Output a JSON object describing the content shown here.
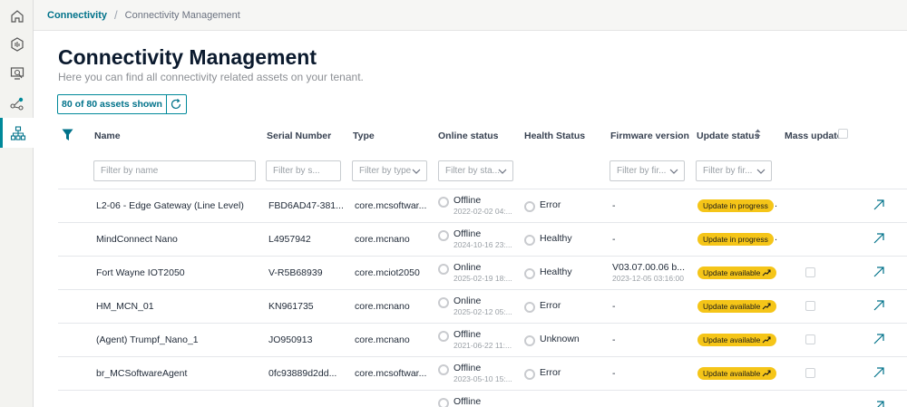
{
  "nav": {
    "items": [
      {
        "icon": "home-icon"
      },
      {
        "icon": "dashboard-icon"
      },
      {
        "icon": "search-monitor-icon"
      },
      {
        "icon": "connection-icon"
      },
      {
        "icon": "hierarchy-icon"
      }
    ]
  },
  "breadcrumb": {
    "link": "Connectivity",
    "current": "Connectivity Management"
  },
  "page": {
    "title": "Connectivity Management",
    "subtitle": "Here you can find all connectivity related assets on your tenant."
  },
  "counter": {
    "label": "80 of 80 assets shown"
  },
  "columns": {
    "name": "Name",
    "serial": "Serial Number",
    "type": "Type",
    "online": "Online status",
    "health": "Health Status",
    "firmware": "Firmware version",
    "update": "Update status",
    "mass": "Mass update"
  },
  "filters": {
    "name": "Filter by name",
    "serial": "Filter by s...",
    "type": "Filter by type",
    "online": "Filter by sta...",
    "firmware": "Filter by fir...",
    "update": "Filter by fir..."
  },
  "colors": {
    "accent": "#00899a",
    "online": "#1a7f37",
    "offline": "#c9cbcf",
    "error": "#c8102e",
    "healthy": "#1a7f37",
    "unknown": "#c9cbcf",
    "pill": "#f5c518"
  },
  "rows": [
    {
      "name": "L2-06 - Edge Gateway (Line Level)",
      "serial": "FBD6AD47-381...",
      "type": "core.mcsoftwar...",
      "online": "Offline",
      "online_time": "2022-02-02 04:...",
      "online_state": "offline",
      "health": "Error",
      "health_state": "error",
      "firmware": "-",
      "firmware_time": "",
      "update": "Update in progress",
      "update_suffix": "."
    },
    {
      "name": "MindConnect Nano",
      "serial": "L4957942",
      "type": "core.mcnano",
      "online": "Offline",
      "online_time": "2024-10-16 23:...",
      "online_state": "offline",
      "health": "Healthy",
      "health_state": "healthy",
      "firmware": "-",
      "firmware_time": "",
      "update": "Update in progress",
      "update_suffix": "."
    },
    {
      "name": "Fort Wayne IOT2050",
      "serial": "V-R5B68939",
      "type": "core.mciot2050",
      "online": "Online",
      "online_time": "2025-02-19 18:...",
      "online_state": "online",
      "health": "Healthy",
      "health_state": "healthy",
      "firmware": "V03.07.00.06 b...",
      "firmware_time": "2023-12-05 03:16:00",
      "update": "Update available",
      "update_suffix": ""
    },
    {
      "name": "HM_MCN_01",
      "serial": "KN961735",
      "type": "core.mcnano",
      "online": "Online",
      "online_time": "2025-02-12 05:...",
      "online_state": "online",
      "health": "Error",
      "health_state": "error",
      "firmware": "-",
      "firmware_time": "",
      "update": "Update available",
      "update_suffix": ""
    },
    {
      "name": "(Agent) Trumpf_Nano_1",
      "serial": "JO950913",
      "type": "core.mcnano",
      "online": "Offline",
      "online_time": "2021-06-22 11:...",
      "online_state": "offline",
      "health": "Unknown",
      "health_state": "unknown",
      "firmware": "-",
      "firmware_time": "",
      "update": "Update available",
      "update_suffix": ""
    },
    {
      "name": "br_MCSoftwareAgent",
      "serial": "0fc93889d2dd...",
      "type": "core.mcsoftwar...",
      "online": "Offline",
      "online_time": "2023-05-10 15:...",
      "online_state": "offline",
      "health": "Error",
      "health_state": "error",
      "firmware": "-",
      "firmware_time": "",
      "update": "Update available",
      "update_suffix": ""
    },
    {
      "name": "",
      "serial": "",
      "type": "",
      "online": "Offline",
      "online_time": "",
      "online_state": "offline",
      "health": "",
      "health_state": "unknown",
      "firmware": "",
      "firmware_time": "",
      "update": "",
      "update_suffix": ""
    }
  ]
}
